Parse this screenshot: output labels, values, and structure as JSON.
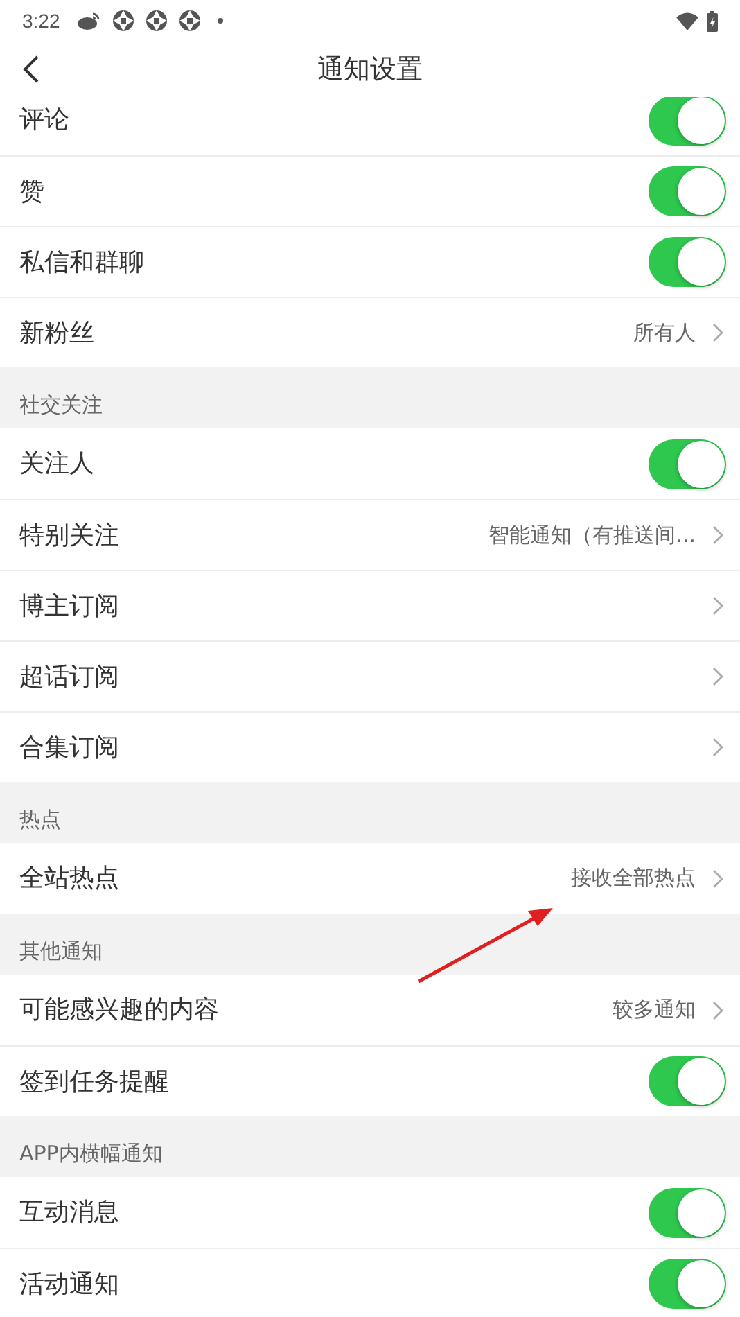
{
  "status_bar": {
    "time": "3:22"
  },
  "header": {
    "title": "通知设置"
  },
  "sections": [
    {
      "rows": [
        {
          "kind": "toggle",
          "label": "评论",
          "on": true
        },
        {
          "kind": "toggle",
          "label": "赞",
          "on": true
        },
        {
          "kind": "toggle",
          "label": "私信和群聊",
          "on": true
        },
        {
          "kind": "link",
          "label": "新粉丝",
          "value": "所有人"
        }
      ]
    },
    {
      "title": "社交关注",
      "rows": [
        {
          "kind": "toggle",
          "label": "关注人",
          "on": true
        },
        {
          "kind": "link",
          "label": "特别关注",
          "value": "智能通知（有推送间..."
        },
        {
          "kind": "link",
          "label": "博主订阅"
        },
        {
          "kind": "link",
          "label": "超话订阅"
        },
        {
          "kind": "link",
          "label": "合集订阅"
        }
      ]
    },
    {
      "title": "热点",
      "rows": [
        {
          "kind": "link",
          "label": "全站热点",
          "value": "接收全部热点"
        }
      ]
    },
    {
      "title": "其他通知",
      "rows": [
        {
          "kind": "link",
          "label": "可能感兴趣的内容",
          "value": "较多通知"
        },
        {
          "kind": "toggle",
          "label": "签到任务提醒",
          "on": true
        }
      ]
    },
    {
      "title": "APP内横幅通知",
      "rows": [
        {
          "kind": "toggle",
          "label": "互动消息",
          "on": true
        },
        {
          "kind": "toggle",
          "label": "活动通知",
          "on": true
        }
      ]
    }
  ]
}
